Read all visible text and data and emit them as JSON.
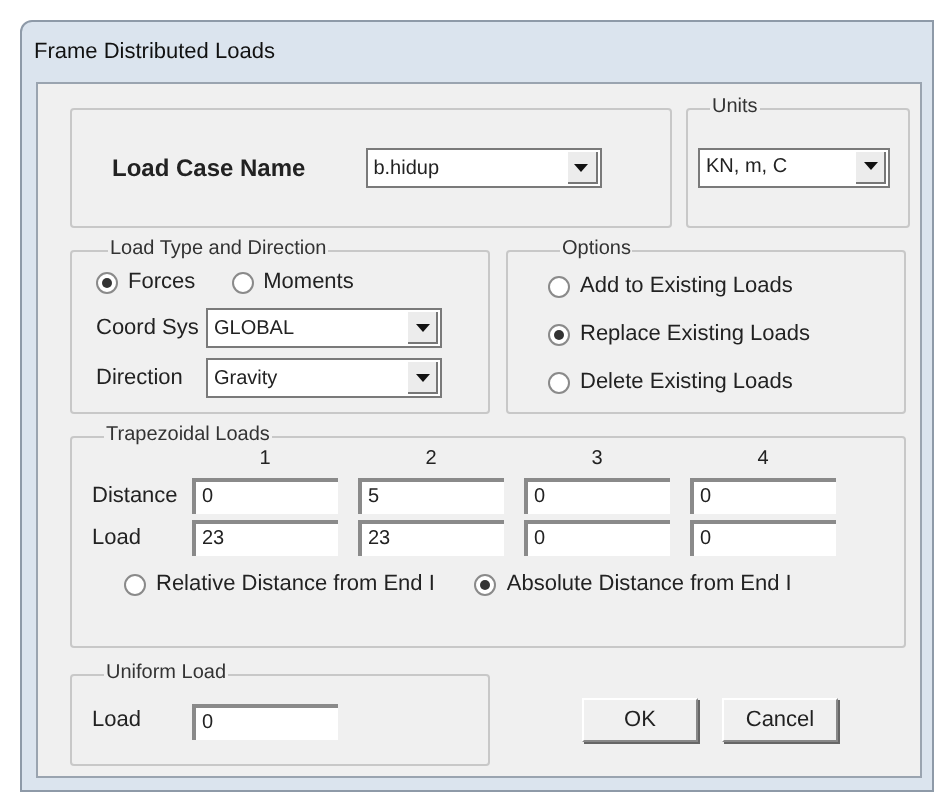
{
  "window": {
    "title": "Frame Distributed Loads"
  },
  "load_case": {
    "label": "Load Case Name",
    "value": "b.hidup"
  },
  "units": {
    "legend": "Units",
    "value": "KN, m, C"
  },
  "load_type": {
    "legend": "Load Type and Direction",
    "types": [
      {
        "label": "Forces",
        "selected": true
      },
      {
        "label": "Moments",
        "selected": false
      }
    ],
    "coord_sys": {
      "label": "Coord Sys",
      "value": "GLOBAL"
    },
    "direction": {
      "label": "Direction",
      "value": "Gravity"
    }
  },
  "options": {
    "legend": "Options",
    "items": [
      {
        "label": "Add to Existing Loads",
        "selected": false
      },
      {
        "label": "Replace Existing Loads",
        "selected": true
      },
      {
        "label": "Delete Existing Loads",
        "selected": false
      }
    ]
  },
  "trapezoidal": {
    "legend": "Trapezoidal Loads",
    "columns": [
      "1",
      "2",
      "3",
      "4"
    ],
    "rows": [
      {
        "label": "Distance",
        "values": [
          "0",
          "5",
          "0",
          "0"
        ]
      },
      {
        "label": "Load",
        "values": [
          "23",
          "23",
          "0",
          "0"
        ]
      }
    ],
    "distance_modes": [
      {
        "label": "Relative Distance from End I",
        "selected": false
      },
      {
        "label": "Absolute Distance from End I",
        "selected": true
      }
    ]
  },
  "uniform": {
    "legend": "Uniform Load",
    "label": "Load",
    "value": "0"
  },
  "buttons": [
    "OK",
    "Cancel"
  ]
}
